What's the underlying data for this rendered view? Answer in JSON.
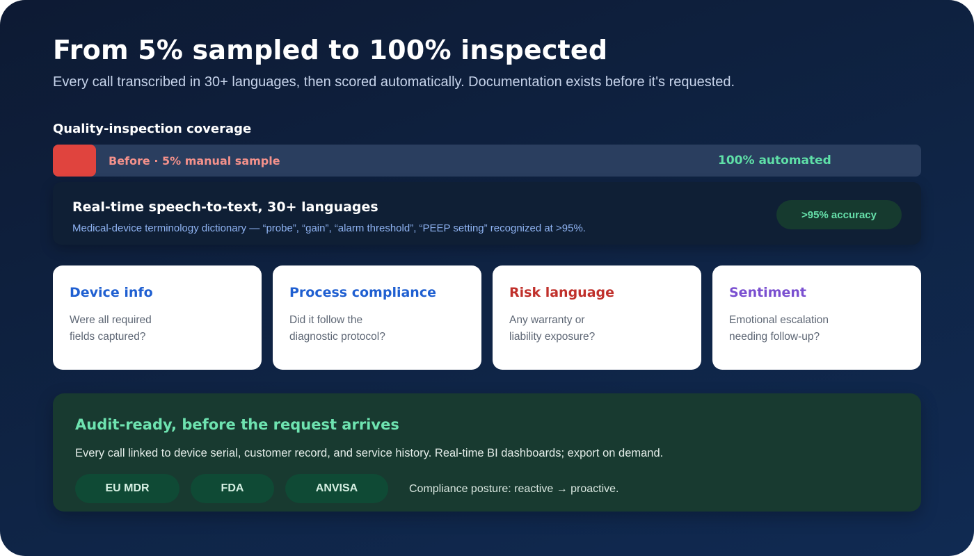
{
  "header": {
    "title": "From 5% sampled to 100% inspected",
    "subtitle": "Every call transcribed in 30+ languages, then scored automatically. Documentation exists before it's requested."
  },
  "coverage": {
    "label": "Quality-inspection coverage",
    "before_label": "Before · 5% manual sample",
    "after_label": "100% automated",
    "before_fraction": 0.05,
    "colors": {
      "before": "#e0443e",
      "track": "#2a3e5f",
      "after_text": "#5fe0a8"
    }
  },
  "speech": {
    "title": "Real-time speech-to-text, 30+ languages",
    "description": "Medical-device terminology dictionary — “probe”, “gain”, “alarm threshold”, “PEEP setting” recognized at >95%.",
    "badge": ">95% accuracy"
  },
  "criteria": [
    {
      "title": "Device info",
      "description": "Were all required fields captured?",
      "color": "#1f5fd1"
    },
    {
      "title": "Process compliance",
      "description": "Did it follow the diagnostic protocol?",
      "color": "#1f5fd1"
    },
    {
      "title": "Risk language",
      "description": "Any warranty or liability exposure?",
      "color": "#c0302b"
    },
    {
      "title": "Sentiment",
      "description": "Emotional escalation needing follow-up?",
      "color": "#7a4fd0"
    }
  ],
  "audit": {
    "title": "Audit-ready, before the request arrives",
    "description": "Every call linked to device serial, customer record, and service history. Real-time BI dashboards; export on demand.",
    "regulators": [
      "EU MDR",
      "FDA",
      "ANVISA"
    ],
    "posture": "Compliance posture: reactive → proactive."
  }
}
